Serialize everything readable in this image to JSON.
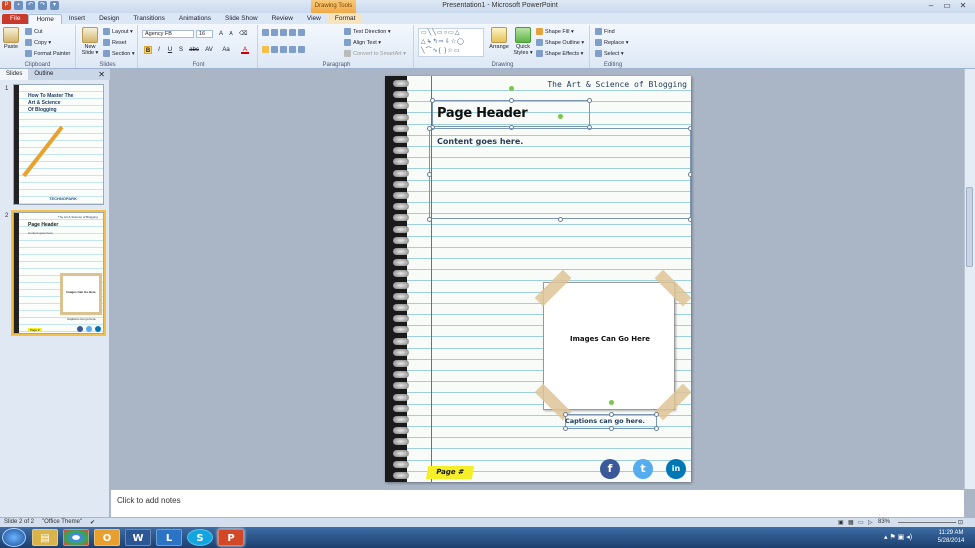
{
  "window": {
    "title": "Presentation1 - Microsoft PowerPoint",
    "contextual_tab": "Drawing Tools",
    "minimize": "–",
    "maximize": "▭",
    "close": "✕"
  },
  "tabs": [
    {
      "label": "File"
    },
    {
      "label": "Home"
    },
    {
      "label": "Insert"
    },
    {
      "label": "Design"
    },
    {
      "label": "Transitions"
    },
    {
      "label": "Animations"
    },
    {
      "label": "Slide Show"
    },
    {
      "label": "Review"
    },
    {
      "label": "View"
    },
    {
      "label": "Format"
    }
  ],
  "ribbon": {
    "clipboard": {
      "group": "Clipboard",
      "paste": "Paste",
      "cut": "Cut",
      "copy": "Copy ▾",
      "format_painter": "Format Painter"
    },
    "slides": {
      "group": "Slides",
      "new_slide": "New Slide ▾",
      "layout": "Layout ▾",
      "reset": "Reset",
      "section": "Section ▾"
    },
    "font": {
      "group": "Font",
      "font_name": "Agency FB",
      "font_size": "16",
      "bold": "B",
      "italic": "I",
      "underline": "U",
      "strike": "S",
      "shadow": "abc",
      "spacing": "AV",
      "case": "Aa",
      "color": "A"
    },
    "paragraph": {
      "group": "Paragraph",
      "text_direction": "Text Direction ▾",
      "align_text": "Align Text ▾",
      "convert_smartart": "Convert to SmartArt ▾"
    },
    "drawing": {
      "group": "Drawing",
      "arrange": "Arrange",
      "quick_styles": "Quick Styles ▾",
      "shape_fill": "Shape Fill ▾",
      "shape_outline": "Shape Outline ▾",
      "shape_effects": "Shape Effects ▾"
    },
    "editing": {
      "group": "Editing",
      "find": "Find",
      "replace": "Replace ▾",
      "select": "Select ▾"
    }
  },
  "left_panel": {
    "tabs": [
      "Slides",
      "Outline"
    ],
    "close": "✕",
    "thumbs": [
      {
        "num": "1",
        "title_line1": "How To Master The",
        "title_line2": "Art & Science",
        "title_line3": "Of Blogging",
        "logo": "TECHNOPARK"
      },
      {
        "num": "2",
        "header": "Page Header",
        "small_top": "The Art & Science of Blogging",
        "content": "Content goes here.",
        "image_text": "Images Can Go Here",
        "caption": "Captions can go here.",
        "page": "Page #"
      }
    ]
  },
  "slide": {
    "top_text": "The Art & Science of Blogging",
    "header": "Page Header",
    "content": "Content goes here.",
    "image_placeholder": "Images Can Go Here",
    "caption": "Captions can go here.",
    "page_number": "Page #",
    "social": {
      "facebook": "f",
      "twitter": "t",
      "linkedin": "in"
    },
    "colors": {
      "facebook": "#3b5998",
      "twitter": "#55acee",
      "linkedin": "#0077b5",
      "page_badge": "#f5ef2a"
    }
  },
  "notes": {
    "placeholder": "Click to add notes"
  },
  "status": {
    "slide": "Slide 2 of 2",
    "theme": "\"Office Theme\"",
    "zoom": "83%"
  },
  "taskbar": {
    "apps": [
      "Explorer",
      "Chrome",
      "Outlook",
      "W",
      "Lync",
      "S",
      "P"
    ],
    "time": "11:29 AM",
    "date": "5/28/2014"
  }
}
